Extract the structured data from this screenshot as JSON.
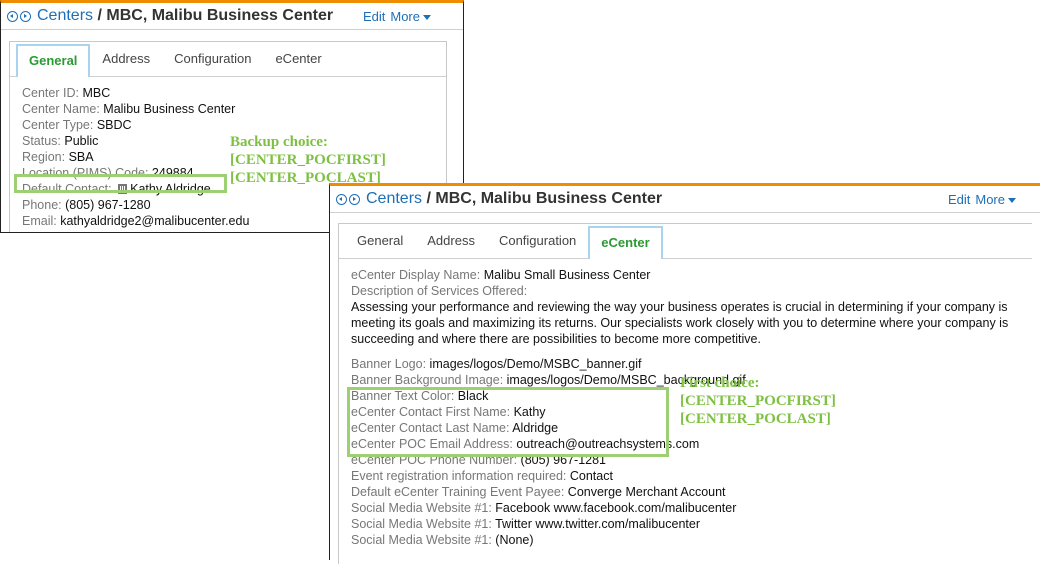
{
  "panel_general": {
    "breadcrumb_root": "Centers",
    "breadcrumb_sep": " / ",
    "breadcrumb_current": "MBC, Malibu Business Center",
    "edit_label": "Edit",
    "more_label": "More",
    "tabs": [
      "General",
      "Address",
      "Configuration",
      "eCenter"
    ],
    "active_tab": "General",
    "fields": [
      {
        "label": "Center ID: ",
        "value": "MBC"
      },
      {
        "label": "Center Name: ",
        "value": "Malibu Business Center"
      },
      {
        "label": "Center Type: ",
        "value": "SBDC"
      },
      {
        "label": "Status: ",
        "value": "Public"
      },
      {
        "label": "Region: ",
        "value": "SBA"
      },
      {
        "label": "Location (PIMS) Code: ",
        "value": "249884"
      },
      {
        "label": "Default Contact: ",
        "value": "Kathy Aldridge"
      },
      {
        "label": "Phone: ",
        "value": "(805) 967-1280"
      },
      {
        "label": "Email: ",
        "value": "kathyaldridge2@malibucenter.edu"
      }
    ]
  },
  "panel_ecenter": {
    "breadcrumb_root": "Centers",
    "breadcrumb_sep": " / ",
    "breadcrumb_current": "MBC, Malibu Business Center",
    "edit_label": "Edit",
    "more_label": "More",
    "tabs": [
      "General",
      "Address",
      "Configuration",
      "eCenter"
    ],
    "active_tab": "eCenter",
    "display_name": {
      "label": "eCenter Display Name: ",
      "value": "Malibu Small Business Center"
    },
    "description_label": "Description of Services Offered:",
    "description_text": "Assessing your performance and reviewing the way your business operates is crucial in determining if your company is meeting its goals and maximizing its returns. Our specialists work closely with you to determine where your company is succeeding and where there are possibilities to become more competitive.",
    "fields": [
      {
        "label": "Banner Logo: ",
        "value": "images/logos/Demo/MSBC_banner.gif"
      },
      {
        "label": "Banner Background Image: ",
        "value": "images/logos/Demo/MSBC_background.gif"
      },
      {
        "label": "Banner Text Color: ",
        "value": "Black"
      },
      {
        "label": "eCenter Contact First Name: ",
        "value": "Kathy"
      },
      {
        "label": "eCenter Contact Last Name: ",
        "value": "Aldridge"
      },
      {
        "label": "eCenter POC Email Address: ",
        "value": "outreach@outreachsystems.com"
      },
      {
        "label": "eCenter POC Phone Number: ",
        "value": "(805) 967-1281"
      },
      {
        "label": "Event registration information required: ",
        "value": "Contact"
      },
      {
        "label": "Default eCenter Training Event Payee: ",
        "value": "Converge Merchant Account"
      },
      {
        "label": "Social Media Website #1: ",
        "value": "Facebook www.facebook.com/malibucenter"
      },
      {
        "label": "Social Media Website #1: ",
        "value": "Twitter www.twitter.com/malibucenter"
      },
      {
        "label": "Social Media Website #1: ",
        "value": "(None)"
      }
    ]
  },
  "annotations": {
    "backup": [
      "Backup choice:",
      "[CENTER_POCFIRST]",
      "[CENTER_POCLAST]"
    ],
    "first": [
      "First choice:",
      "[CENTER_POCFIRST]",
      "[CENTER_POCLAST]"
    ],
    "color": "#7ec142"
  },
  "colors": {
    "accent_orange": "#f08c00",
    "link_blue": "#1d6fb8",
    "active_tab_green": "#2a9a32",
    "highlight_green": "#9dcf73"
  }
}
